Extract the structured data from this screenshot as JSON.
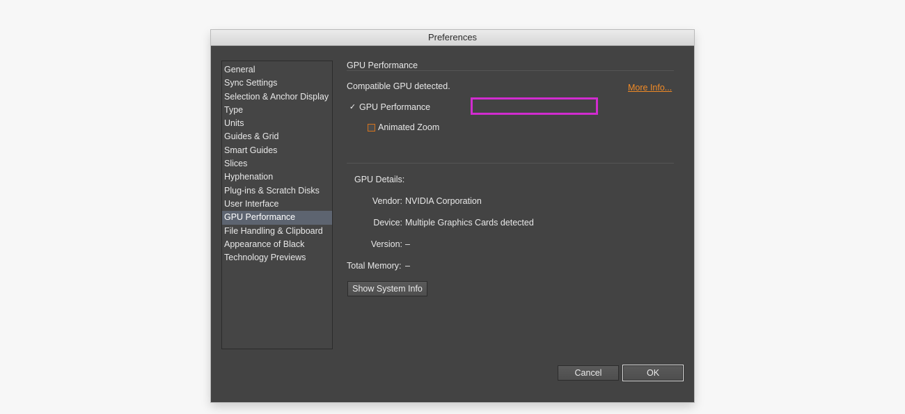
{
  "window": {
    "title": "Preferences"
  },
  "sidebar": {
    "items": [
      {
        "label": "General"
      },
      {
        "label": "Sync Settings"
      },
      {
        "label": "Selection & Anchor Display"
      },
      {
        "label": "Type"
      },
      {
        "label": "Units"
      },
      {
        "label": "Guides & Grid"
      },
      {
        "label": "Smart Guides"
      },
      {
        "label": "Slices"
      },
      {
        "label": "Hyphenation"
      },
      {
        "label": "Plug-ins & Scratch Disks"
      },
      {
        "label": "User Interface"
      },
      {
        "label": "GPU Performance",
        "selected": true
      },
      {
        "label": "File Handling & Clipboard"
      },
      {
        "label": "Appearance of Black"
      },
      {
        "label": "Technology Previews"
      }
    ]
  },
  "main": {
    "section_title": "GPU Performance",
    "compatible_text": "Compatible GPU detected.",
    "more_info_link": "More Info...",
    "gpu_checkbox": {
      "label": "GPU Performance",
      "checked": true
    },
    "zoom_checkbox": {
      "label": "Animated Zoom",
      "checked": false
    },
    "details_title": "GPU Details:",
    "vendor_label": "Vendor:",
    "vendor_value": "NVIDIA Corporation",
    "device_label": "Device:",
    "device_value": "Multiple Graphics Cards detected",
    "version_label": "Version:",
    "version_value": "–",
    "memory_label": "Total Memory:",
    "memory_value": "–",
    "show_system_info": "Show System Info"
  },
  "footer": {
    "cancel": "Cancel",
    "ok": "OK"
  },
  "colors": {
    "highlight": "#d12ccf",
    "link": "#f08a26",
    "selection": "#5d6470"
  }
}
